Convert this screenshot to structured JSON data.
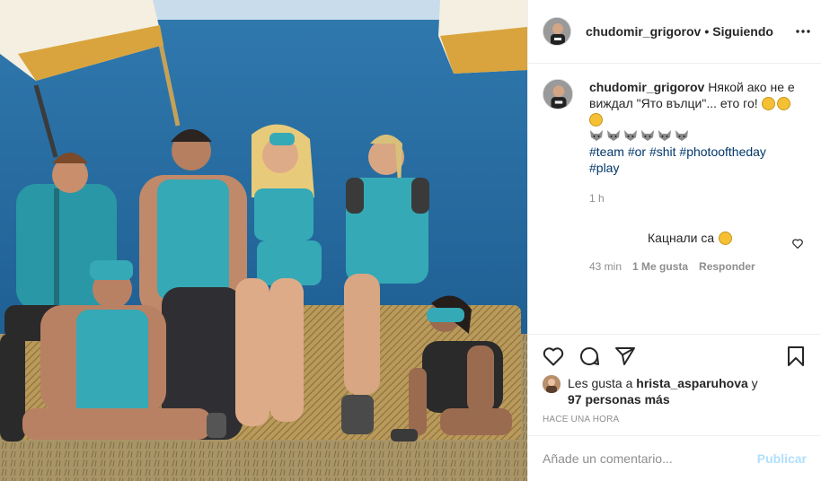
{
  "header": {
    "username": "chudomir_grigorov",
    "separator": "•",
    "follow_status": "Siguiendo",
    "more_icon": "more-horizontal-icon"
  },
  "caption": {
    "username": "chudomir_grigorov",
    "text": "Някой ако не е виждал \"Ято вълци\"... ето го!",
    "hashtags": [
      "#team",
      "#or",
      "#shit",
      "#photooftheday",
      "#play"
    ],
    "time": "1 h"
  },
  "reply": {
    "text": "Кацнали са",
    "time": "43 min",
    "likes": "1 Me gusta",
    "reply_label": "Responder"
  },
  "actions": {
    "like_icon": "heart-icon",
    "comment_icon": "comment-icon",
    "share_icon": "share-icon",
    "save_icon": "bookmark-icon"
  },
  "likes": {
    "prefix": "Les gusta a",
    "user": "hrista_asparuhova",
    "conj": "y",
    "others": "97 personas más"
  },
  "posted": "HACE UNA HORA",
  "add_comment": {
    "placeholder": "Añade un comentario...",
    "publish_label": "Publicar"
  },
  "colors": {
    "link": "#00376b",
    "muted": "#8e8e8e",
    "publish_disabled": "#b2dffc",
    "team_teal": "#34a6b3"
  }
}
